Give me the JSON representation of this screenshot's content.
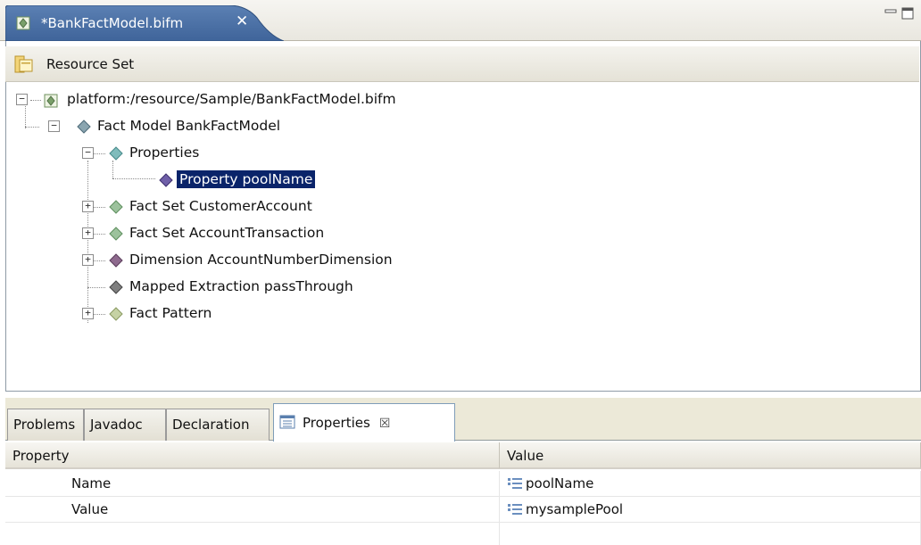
{
  "editor": {
    "tab_title": "*BankFactModel.bifm",
    "close_glyph": "✕",
    "tab_icon": "fact-model-file-icon"
  },
  "resource_set": {
    "label": "Resource Set",
    "icon": "resource-set-icon"
  },
  "tree": {
    "items": [
      {
        "label": "platform:/resource/Sample/BankFactModel.bifm",
        "toggle": "−",
        "icon": "fact-model-file-icon"
      },
      {
        "label": "Fact Model BankFactModel",
        "toggle": "−",
        "icon": "diamond-icon"
      },
      {
        "label": "Properties",
        "toggle": "−",
        "icon": "diamond-icon"
      },
      {
        "label": "Property poolName",
        "toggle": "",
        "icon": "diamond-icon",
        "selected": true
      },
      {
        "label": "Fact Set CustomerAccount",
        "toggle": "+",
        "icon": "diamond-icon"
      },
      {
        "label": "Fact Set AccountTransaction",
        "toggle": "+",
        "icon": "diamond-icon"
      },
      {
        "label": "Dimension AccountNumberDimension",
        "toggle": "+",
        "icon": "diamond-icon"
      },
      {
        "label": "Mapped Extraction passThrough",
        "toggle": "",
        "icon": "diamond-icon"
      },
      {
        "label": "Fact Pattern",
        "toggle": "+",
        "icon": "diamond-icon"
      }
    ]
  },
  "views": {
    "tabs": [
      {
        "label": "Problems"
      },
      {
        "label": "Javadoc"
      },
      {
        "label": "Declaration"
      },
      {
        "label": "Properties",
        "active": true,
        "close_glyph": "☒"
      }
    ]
  },
  "properties": {
    "columns": [
      "Property",
      "Value"
    ],
    "rows": [
      {
        "property": "Name",
        "value": "poolName"
      },
      {
        "property": "Value",
        "value": "mysamplePool"
      }
    ]
  },
  "colors": {
    "tab_active": "#4a6e9f",
    "selection": "#0a246a",
    "diamond_teal": "#6aa7a7",
    "diamond_purple": "#5c4a8c"
  }
}
